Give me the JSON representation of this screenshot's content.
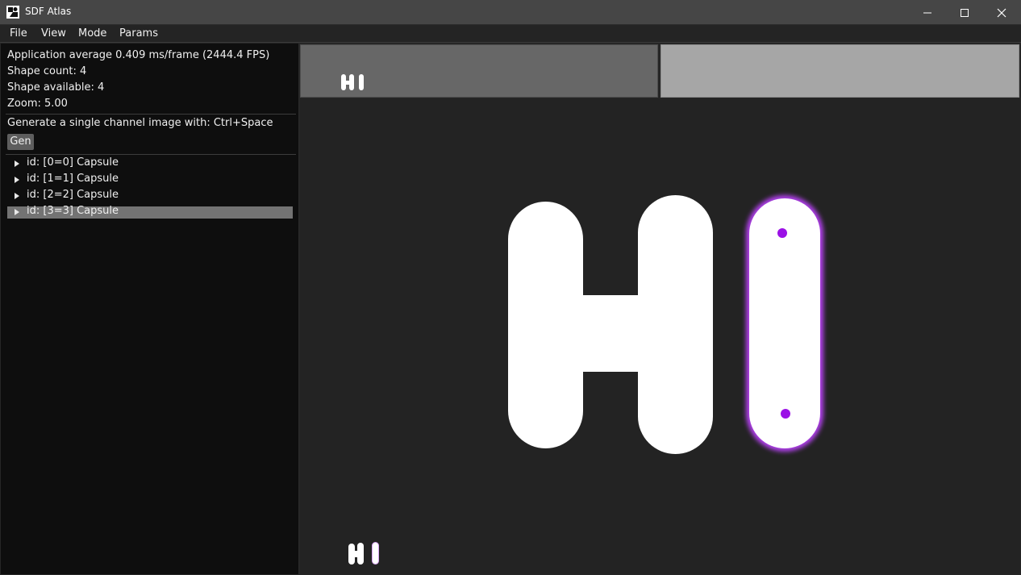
{
  "window": {
    "title": "SDF Atlas"
  },
  "menu": [
    "File",
    "View",
    "Mode",
    "Params"
  ],
  "stats": {
    "fps_line": "Application average 0.409 ms/frame (2444.4 FPS)",
    "shape_count": "Shape count: 4",
    "shape_available": "Shape available: 4",
    "zoom": "Zoom: 5.00"
  },
  "generate": {
    "hint": "Generate a single channel image with: Ctrl+Space",
    "button_label": "Gen"
  },
  "shapes": [
    {
      "label": "id: [0=0] Capsule",
      "selected": false
    },
    {
      "label": "id: [1=1] Capsule",
      "selected": false
    },
    {
      "label": "id: [2=2] Capsule",
      "selected": false
    },
    {
      "label": "id: [3=3] Capsule",
      "selected": true
    }
  ],
  "colors": {
    "selection_highlight": "#9b11e6",
    "shape_fill": "#ffffff",
    "selected_row": "#737373"
  },
  "icons": [
    "app-icon",
    "minimize-icon",
    "maximize-icon",
    "close-icon",
    "tree-expand-arrow-icon"
  ]
}
